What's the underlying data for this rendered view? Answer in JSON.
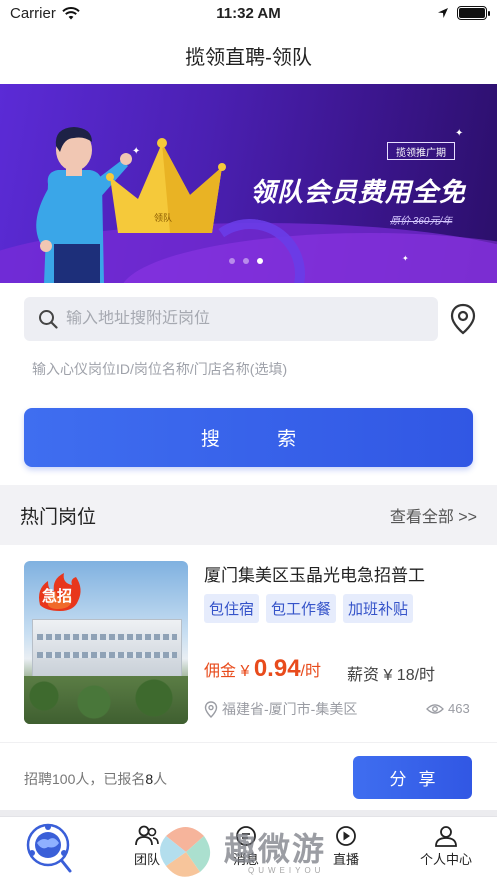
{
  "status_bar": {
    "carrier": "Carrier",
    "time": "11:32 AM",
    "battery_level": 1.0
  },
  "nav": {
    "title": "揽领直聘-领队"
  },
  "banner": {
    "promo_tag": "揽领推广期",
    "headline": "领队会员费用全免",
    "original_price": "原价 360元/年",
    "crown_label": "领队",
    "slides_count": 3,
    "active_slide": 3
  },
  "search": {
    "address_placeholder": "输入地址搜附近岗位",
    "keyword_placeholder": "输入心仪岗位ID/岗位名称/门店名称(选填)",
    "button_label": "搜  索"
  },
  "hot_jobs": {
    "title": "热门岗位",
    "view_all": "查看全部 >>"
  },
  "job": {
    "badge": "急招",
    "title": "厦门集美区玉晶光电急招普工",
    "tags": [
      "包住宿",
      "包工作餐",
      "加班补贴"
    ],
    "commission_label": "佣金",
    "commission_currency": "¥",
    "commission_value": "0.94",
    "commission_unit": "/时",
    "salary": "薪资 ¥ 18/时",
    "location": "福建省-厦门市-集美区",
    "views": "463"
  },
  "recruit": {
    "info_prefix": "招聘100人，已报名",
    "signed_up": "8",
    "info_suffix": "人",
    "share_label": "分享"
  },
  "tabbar": {
    "items": [
      {
        "label": "",
        "icon": "home-globe-icon"
      },
      {
        "label": "团队",
        "icon": "team-icon"
      },
      {
        "label": "消息",
        "icon": "message-icon"
      },
      {
        "label": "直播",
        "icon": "live-icon"
      },
      {
        "label": "个人中心",
        "icon": "profile-icon"
      }
    ]
  },
  "watermark": {
    "text": "趣微游",
    "sub": "QUWEIYOU"
  },
  "colors": {
    "primary": "#3157e4",
    "accent_red": "#e84b1c",
    "tag_bg": "#e6ecfc",
    "banner_purple": "#4b20b3"
  }
}
